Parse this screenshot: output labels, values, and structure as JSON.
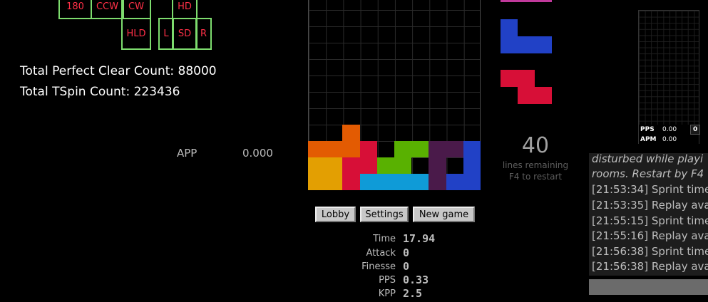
{
  "keys": {
    "rotate_180": "180",
    "rotate_ccw": "CCW",
    "rotate_cw": "CW",
    "hard_drop": "HD",
    "hold": "HLD",
    "left": "L",
    "soft_drop": "SD",
    "right": "R"
  },
  "totals": {
    "perfect_clear": "Total Perfect Clear Count: 88000",
    "tspin": "Total TSpin Count: 223436"
  },
  "app": {
    "label": "APP",
    "value": "0.000"
  },
  "colors": {
    "I": "#0f9bd7",
    "O": "#e39f02",
    "T": "#af298a",
    "S": "#59b101",
    "Z": "#d70f37",
    "J": "#2141c6",
    "L": "#e35b02",
    "G": "#4a1a4a",
    "magenta": "#c0399b",
    "key_border": "#7ddc6e",
    "key_text": "#ff3047"
  },
  "board": {
    "rows": [
      "..........",
      "..........",
      "..........",
      "..........",
      "..........",
      "..........",
      "..........",
      "..........",
      "..L.......",
      "LLLZ.SSGGJ",
      "OOZZSS.G.J",
      "OOZIIIIGJJ"
    ]
  },
  "queue": {
    "pieces": [
      "T",
      "J",
      "Z"
    ]
  },
  "lines": {
    "count": "40",
    "label": "lines remaining",
    "hint": "F4 to restart"
  },
  "buttons": {
    "lobby": "Lobby",
    "settings": "Settings",
    "new_game": "New game"
  },
  "stats": [
    {
      "label": "Time",
      "value": "17.94"
    },
    {
      "label": "Attack",
      "value": "0"
    },
    {
      "label": "Finesse",
      "value": "0"
    },
    {
      "label": "PPS",
      "value": "0.33"
    },
    {
      "label": "KPP",
      "value": "2.5"
    }
  ],
  "mini": {
    "pps_label": "PPS",
    "pps_value": "0.00",
    "apm_label": "APM",
    "apm_value": "0.00",
    "count": "0"
  },
  "chat": {
    "lines": [
      "disturbed while playi",
      "rooms. Restart by F4",
      "[21:53:34] Sprint time",
      "[21:53:35] Replay avai",
      "[21:55:15] Sprint time:",
      "[21:55:16] Replay avai",
      "[21:56:38] Sprint time",
      "[21:56:38] Replay ava"
    ]
  }
}
